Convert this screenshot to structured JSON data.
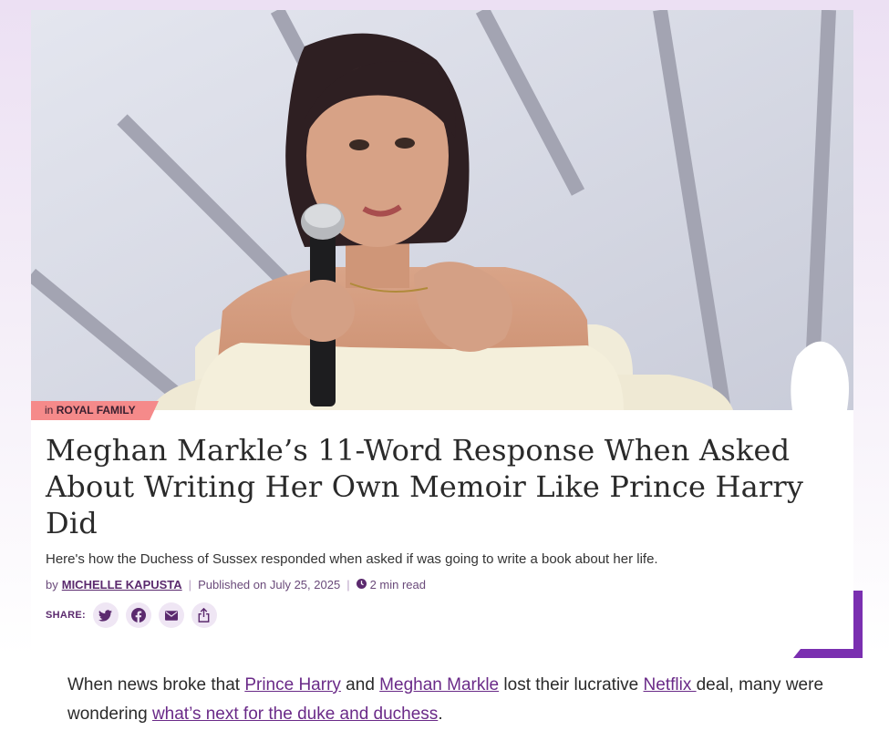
{
  "hero": {
    "image": "meghan-speaking-microphone-photo"
  },
  "category": {
    "prefix": "in",
    "name": "ROYAL FAMILY"
  },
  "article": {
    "title": "Meghan Markle’s 11-Word Response When Asked About Writing Her Own Memoir Like Prince Harry Did",
    "dek": "Here's how the Duchess of Sussex responded when asked if was going to write a book about her life.",
    "byline": {
      "by": "by",
      "author": "MICHELLE KAPUSTA",
      "sep": "|",
      "published": "Published on July 25, 2025",
      "read_time": "2 min read"
    },
    "share": {
      "label": "SHARE:",
      "icons": [
        "twitter-icon",
        "facebook-icon",
        "email-icon",
        "share-icon"
      ]
    },
    "body": {
      "t1": "When news broke that ",
      "l1": "Prince Harry",
      "t2": " and ",
      "l2": "Meghan Markle",
      "t3": " lost their lucrative ",
      "l3": "Netflix ",
      "t4": "deal, many were wondering ",
      "l4": "what’s next for the duke and duchess",
      "t5": "."
    }
  },
  "colors": {
    "accent": "#7a2fb0",
    "category_bg": "#f58a8a",
    "link": "#6a2a88",
    "share_bg": "#efe6f4"
  }
}
